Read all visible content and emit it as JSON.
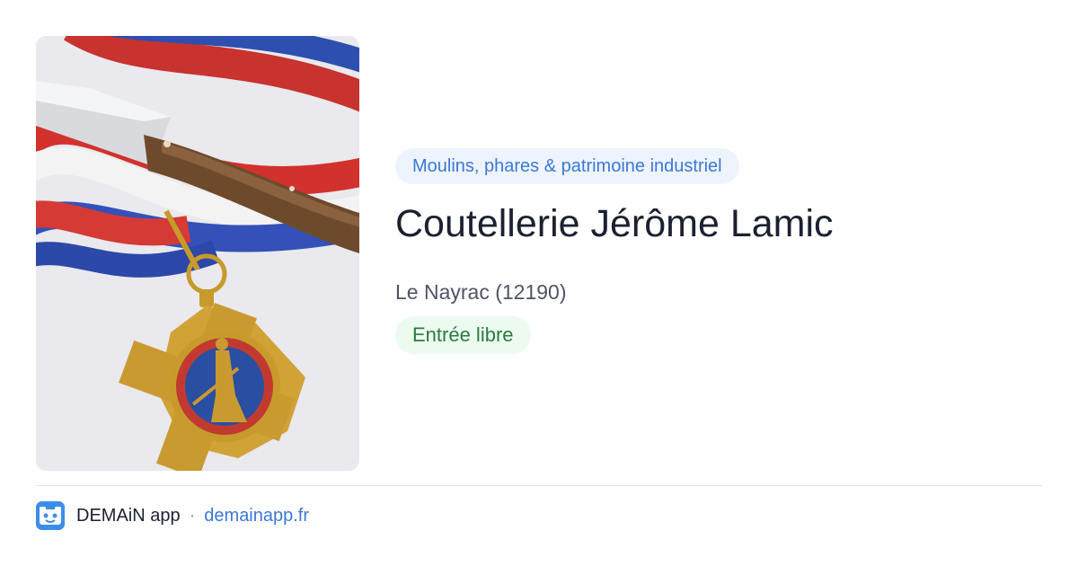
{
  "place": {
    "category": "Moulins, phares & patrimoine industriel",
    "name": "Coutellerie Jérôme Lamic",
    "location": "Le Nayrac (12190)",
    "access": "Entrée libre"
  },
  "footer": {
    "app_name": "DEMAiN app",
    "separator": "·",
    "url": "demainapp.fr",
    "app_icon": "demain-app-logo-icon"
  },
  "colors": {
    "category_bg": "#eef4fd",
    "category_text": "#3b78d8",
    "access_bg": "#ecfaf0",
    "access_text": "#2a7c3e",
    "title_text": "#1b2130",
    "link": "#3b78d8"
  }
}
